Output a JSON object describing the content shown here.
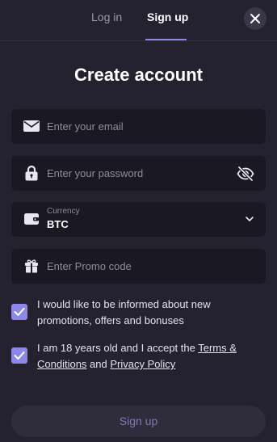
{
  "tabs": {
    "login": "Log in",
    "signup": "Sign up"
  },
  "title": "Create account",
  "fields": {
    "email_placeholder": "Enter your email",
    "password_placeholder": "Enter your password",
    "currency_label": "Currency",
    "currency_value": "BTC",
    "promo_placeholder": "Enter Promo code"
  },
  "consents": {
    "marketing_text": "I would like to be informed about new promotions, offers and bonuses",
    "terms_prefix": "I am 18 years old and I accept the ",
    "terms_link": "Terms & Conditions",
    "terms_and": " and ",
    "privacy_link": "Privacy Policy",
    "marketing_checked": true,
    "terms_checked": true
  },
  "submit_label": "Sign up",
  "colors": {
    "background": "#24222f",
    "field_background": "#1a1822",
    "accent": "#8c87e8",
    "button_background": "#2f2d3b",
    "button_text": "#7e7bb8"
  },
  "icons": [
    "close-icon",
    "mail-icon",
    "lock-icon",
    "eye-off-icon",
    "wallet-icon",
    "chevron-down-icon",
    "gift-icon",
    "check-icon"
  ]
}
